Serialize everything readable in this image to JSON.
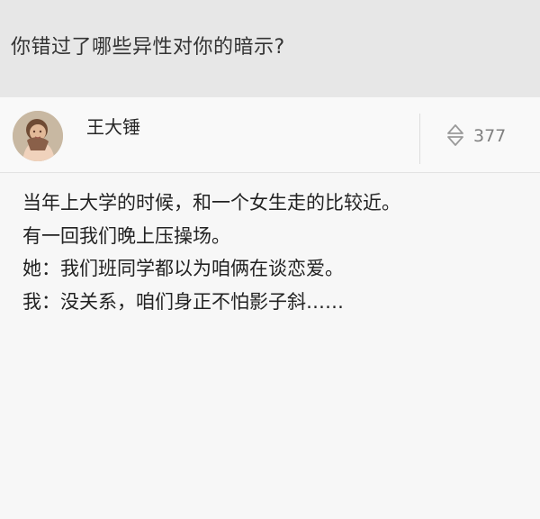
{
  "question": {
    "title": "你错过了哪些异性对你的暗示?"
  },
  "answer": {
    "author_name": "王大锤",
    "vote_count": "377",
    "lines": [
      "当年上大学的时候，和一个女生走的比较近。",
      "有一回我们晚上压操场。",
      "她：我们班同学都以为咱俩在谈恋爱。",
      "我：没关系，咱们身正不怕影子斜……"
    ]
  },
  "colors": {
    "question_background": "#e7e7e7",
    "page_background": "#f7f7f7",
    "text": "#222222",
    "muted_text": "#7f7f7f"
  },
  "icons": {
    "vote": "up-down-vote-icon"
  }
}
